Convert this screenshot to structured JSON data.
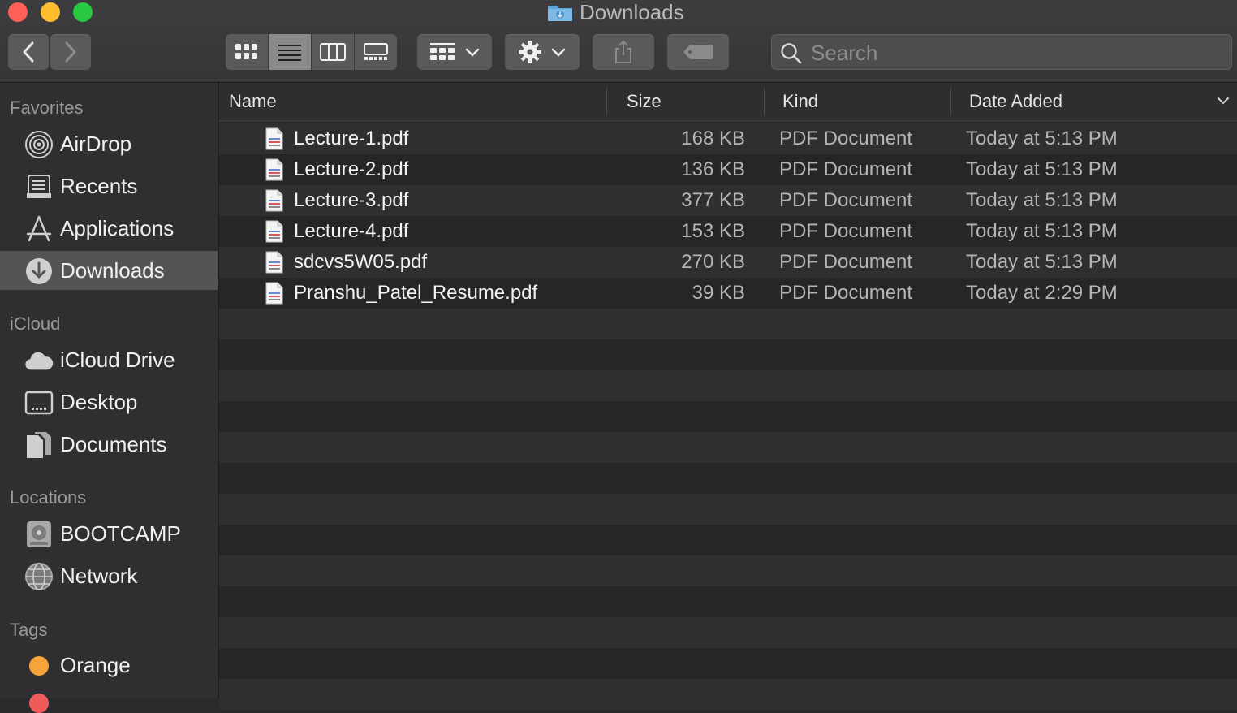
{
  "window": {
    "title": "Downloads"
  },
  "toolbar": {
    "search_placeholder": "Search"
  },
  "sidebar": {
    "sections": [
      {
        "title": "Favorites",
        "items": [
          {
            "label": "AirDrop",
            "icon": "airdrop-icon"
          },
          {
            "label": "Recents",
            "icon": "recents-icon"
          },
          {
            "label": "Applications",
            "icon": "applications-icon"
          },
          {
            "label": "Downloads",
            "icon": "downloads-icon",
            "selected": true
          }
        ]
      },
      {
        "title": "iCloud",
        "items": [
          {
            "label": "iCloud Drive",
            "icon": "cloud-icon"
          },
          {
            "label": "Desktop",
            "icon": "desktop-icon"
          },
          {
            "label": "Documents",
            "icon": "documents-icon"
          }
        ]
      },
      {
        "title": "Locations",
        "items": [
          {
            "label": "BOOTCAMP",
            "icon": "disk-icon"
          },
          {
            "label": "Network",
            "icon": "network-icon"
          }
        ]
      },
      {
        "title": "Tags",
        "items": [
          {
            "label": "Orange",
            "icon": "orange-tag-icon",
            "color": "#f5a33a"
          }
        ]
      }
    ]
  },
  "columns": {
    "name": "Name",
    "size": "Size",
    "kind": "Kind",
    "date": "Date Added"
  },
  "files": [
    {
      "name": "Lecture-1.pdf",
      "size": "168 KB",
      "kind": "PDF Document",
      "date": "Today at 5:13 PM"
    },
    {
      "name": "Lecture-2.pdf",
      "size": "136 KB",
      "kind": "PDF Document",
      "date": "Today at 5:13 PM"
    },
    {
      "name": "Lecture-3.pdf",
      "size": "377 KB",
      "kind": "PDF Document",
      "date": "Today at 5:13 PM"
    },
    {
      "name": "Lecture-4.pdf",
      "size": "153 KB",
      "kind": "PDF Document",
      "date": "Today at 5:13 PM"
    },
    {
      "name": "sdcvs5W05.pdf",
      "size": "270 KB",
      "kind": "PDF Document",
      "date": "Today at 5:13 PM"
    },
    {
      "name": "Pranshu_Patel_Resume.pdf",
      "size": "39 KB",
      "kind": "PDF Document",
      "date": "Today at 2:29 PM"
    }
  ],
  "colors": {
    "selection": "#545456",
    "accent": "#4a9be8"
  }
}
